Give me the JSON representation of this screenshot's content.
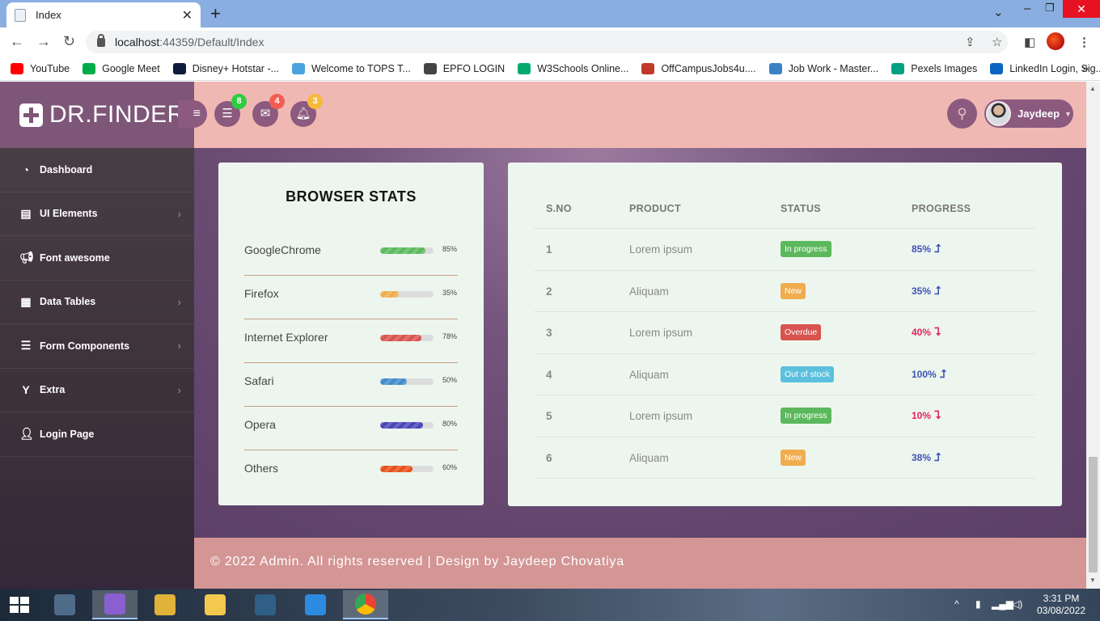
{
  "browser": {
    "tab_title": "Index",
    "url_host": "localhost",
    "url_path": ":44359/Default/Index",
    "bookmarks": [
      {
        "label": "YouTube",
        "color": "#ff0000"
      },
      {
        "label": "Google Meet",
        "color": "#00ac47"
      },
      {
        "label": "Disney+ Hotstar -...",
        "color": "#0f1a3d"
      },
      {
        "label": "Welcome to TOPS T...",
        "color": "#4aa3df"
      },
      {
        "label": "EPFO LOGIN",
        "color": "#444444"
      },
      {
        "label": "W3Schools Online...",
        "color": "#04aa6d"
      },
      {
        "label": "OffCampusJobs4u....",
        "color": "#c0392b"
      },
      {
        "label": "Job Work - Master...",
        "color": "#3b82c4"
      },
      {
        "label": "Pexels Images",
        "color": "#05a081"
      },
      {
        "label": "LinkedIn Login, Sig...",
        "color": "#0a66c2"
      }
    ]
  },
  "app": {
    "brand": "DR.FINDER",
    "badges": {
      "messages": "8",
      "mail": "4",
      "alerts": "3"
    },
    "badge_colors": {
      "messages": "#2ecc40",
      "mail": "#f25c54",
      "alerts": "#f6b93b"
    },
    "user_name": "Jaydeep",
    "nav": [
      {
        "label": "Dashboard",
        "icon": "dashboard-icon",
        "has_submenu": false
      },
      {
        "label": "UI Elements",
        "icon": "book-icon",
        "has_submenu": true
      },
      {
        "label": "Font awesome",
        "icon": "bullhorn-icon",
        "has_submenu": false
      },
      {
        "label": "Data Tables",
        "icon": "table-icon",
        "has_submenu": true
      },
      {
        "label": "Form Components",
        "icon": "form-icon",
        "has_submenu": true
      },
      {
        "label": "Extra",
        "icon": "glass-icon",
        "has_submenu": true
      },
      {
        "label": "Login Page",
        "icon": "user-icon",
        "has_submenu": false
      }
    ]
  },
  "browser_stats": {
    "title": "BROWSER STATS",
    "items": [
      {
        "name": "GoogleChrome",
        "percent": 85,
        "label": "85%",
        "color": "#5cb85c"
      },
      {
        "name": "Firefox",
        "percent": 35,
        "label": "35%",
        "color": "#f0ad4e"
      },
      {
        "name": "Internet Explorer",
        "percent": 78,
        "label": "78%",
        "color": "#d9534f"
      },
      {
        "name": "Safari",
        "percent": 50,
        "label": "50%",
        "color": "#428bca"
      },
      {
        "name": "Opera",
        "percent": 80,
        "label": "80%",
        "color": "#4a46b8"
      },
      {
        "name": "Others",
        "percent": 60,
        "label": "60%",
        "color": "#e8501a"
      }
    ]
  },
  "products_table": {
    "headers": [
      "S.NO",
      "PRODUCT",
      "STATUS",
      "PROGRESS"
    ],
    "rows": [
      {
        "sno": "1",
        "product": "Lorem ipsum",
        "status": "In progress",
        "status_color": "#5cb85c",
        "progress": "85%",
        "trend": "up"
      },
      {
        "sno": "2",
        "product": "Aliquam",
        "status": "New",
        "status_color": "#f0ad4e",
        "progress": "35%",
        "trend": "up"
      },
      {
        "sno": "3",
        "product": "Lorem ipsum",
        "status": "Overdue",
        "status_color": "#d9534f",
        "progress": "40%",
        "trend": "down"
      },
      {
        "sno": "4",
        "product": "Aliquam",
        "status": "Out of stock",
        "status_color": "#5bc0de",
        "progress": "100%",
        "trend": "up"
      },
      {
        "sno": "5",
        "product": "Lorem ipsum",
        "status": "In progress",
        "status_color": "#5cb85c",
        "progress": "10%",
        "trend": "down"
      },
      {
        "sno": "6",
        "product": "Aliquam",
        "status": "New",
        "status_color": "#f0ad4e",
        "progress": "38%",
        "trend": "up"
      }
    ],
    "trend_colors": {
      "up": "#3f51b5",
      "down": "#e0245e"
    }
  },
  "footer": {
    "text": "© 2022 Admin. All rights reserved | Design by Jaydeep Chovatiya"
  },
  "taskbar": {
    "time": "3:31 PM",
    "date": "03/08/2022"
  }
}
